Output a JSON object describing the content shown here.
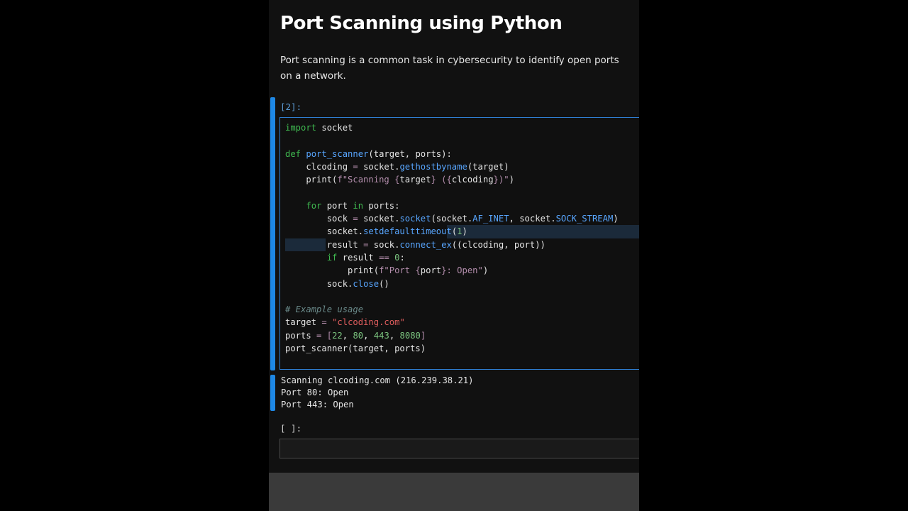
{
  "notebook": {
    "title": "Port Scanning using Python",
    "description": "Port scanning is a common task in cybersecurity to identify open ports on a network.",
    "code_cell": {
      "prompt": "[2]:",
      "lines": [
        "import socket",
        "",
        "def port_scanner(target, ports):",
        "    clcoding = socket.gethostbyname(target)",
        "    print(f\"Scanning {target} ({clcoding})\")",
        "",
        "    for port in ports:",
        "        sock = socket.socket(socket.AF_INET, socket.SOCK_STREAM)",
        "        socket.setdefaulttimeout(1)",
        "        result = sock.connect_ex((clcoding, port))",
        "        if result == 0:",
        "            print(f\"Port {port}: Open\")",
        "        sock.close()",
        "",
        "# Example usage",
        "target = \"clcoding.com\"",
        "ports = [22, 80, 443, 8080]",
        "port_scanner(target, ports)"
      ]
    },
    "output_lines": [
      "Scanning clcoding.com (216.239.38.21)",
      "Port 80: Open",
      "Port 443: Open"
    ],
    "empty_cell": {
      "prompt": "[ ]:"
    },
    "colors": {
      "accent": "#1e88e5",
      "keyword": "#3fb950",
      "function": "#58a6ff",
      "string": "#e05d5d",
      "comment": "#6a8a8a"
    }
  }
}
